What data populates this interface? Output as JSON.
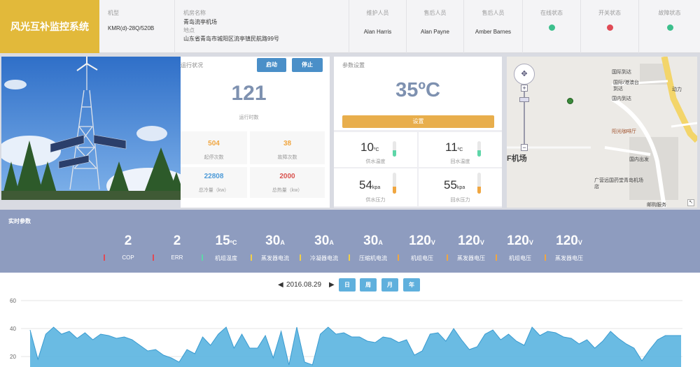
{
  "brand": "风光互补监控系统",
  "header": {
    "model_label": "机型",
    "model_value": "KMR(d)-28Q/520B",
    "room_label": "机房名称",
    "room_value": "青岛流亭机场",
    "addr_label": "地点",
    "addr_value": "山东省青岛市城阳区流亭镇民航路99号",
    "staff": [
      {
        "label": "维护人员",
        "name": "Alan Harris"
      },
      {
        "label": "售后人员",
        "name": "Alan Payne"
      },
      {
        "label": "售后人员",
        "name": "Amber Barnes"
      }
    ],
    "status": [
      {
        "label": "在线状态",
        "color": "#3cbf8c"
      },
      {
        "label": "开关状态",
        "color": "#e04a55"
      },
      {
        "label": "故障状态",
        "color": "#3cbf8c"
      }
    ]
  },
  "run": {
    "title": "运行状况",
    "start_label": "启动",
    "stop_label": "停止",
    "hours": "121",
    "hours_label": "运行时数",
    "starts_value": "504",
    "starts_label": "起停次数",
    "faults_value": "38",
    "faults_label": "故障次数",
    "cool_value": "22808",
    "cool_label": "总冷量（kw）",
    "heat_value": "2000",
    "heat_label": "总热量（kw）",
    "colors": {
      "orange": "#f0a640",
      "blue": "#4d9bd8",
      "red": "#d9534f"
    }
  },
  "params": {
    "title": "参数设置",
    "setpoint": "35ºC",
    "set_label": "设置",
    "supply_temp": "10",
    "supply_temp_unit": "ºC",
    "supply_temp_label": "供水温度",
    "return_temp": "11",
    "return_temp_unit": "ºC",
    "return_temp_label": "回水温度",
    "supply_press": "54",
    "supply_press_unit": "kpa",
    "supply_press_label": "供水压力",
    "return_press": "55",
    "return_press_unit": "kpa",
    "return_press_label": "回水压力"
  },
  "map": {
    "labels": [
      "国际到达",
      "国际/港澳台到达",
      "动力",
      "国内到达",
      "阳光咖啡厅",
      "国内出发",
      "F机场",
      "广营远国药堂青岛机场店",
      "邮购服务"
    ]
  },
  "realtime": {
    "title": "实时参数",
    "items": [
      {
        "value": "2",
        "unit": "",
        "label": "COP",
        "color": "#e04a55"
      },
      {
        "value": "2",
        "unit": "",
        "label": "ERR",
        "color": "#e04a55"
      },
      {
        "value": "15",
        "unit": "ºC",
        "label": "机组温度",
        "color": "#5ed6a8"
      },
      {
        "value": "30",
        "unit": "A",
        "label": "蒸发器电流",
        "color": "#f2d048"
      },
      {
        "value": "30",
        "unit": "A",
        "label": "冷凝器电流",
        "color": "#f2d048"
      },
      {
        "value": "30",
        "unit": "A",
        "label": "压缩机电流",
        "color": "#f2d048"
      },
      {
        "value": "120",
        "unit": "V",
        "label": "机组电压",
        "color": "#f0a640"
      },
      {
        "value": "120",
        "unit": "V",
        "label": "蒸发器电压",
        "color": "#f0a640"
      },
      {
        "value": "120",
        "unit": "V",
        "label": "机组电压",
        "color": "#f0a640"
      },
      {
        "value": "120",
        "unit": "V",
        "label": "蒸发器电压",
        "color": "#f0a640"
      }
    ]
  },
  "chart_toolbar": {
    "prev_icon": "◀",
    "next_icon": "▶",
    "date": "2016.08.29",
    "day": "日",
    "week": "周",
    "month": "月",
    "year": "年"
  },
  "chart_data": {
    "type": "area",
    "yticks": [
      "60",
      "40",
      "20"
    ],
    "ylim": [
      0,
      62
    ],
    "color": "#5ab4e0",
    "values": [
      39,
      18,
      36,
      41,
      36,
      38,
      33,
      37,
      32,
      36,
      35,
      33,
      34,
      32,
      28,
      24,
      25,
      21,
      19,
      16,
      25,
      22,
      34,
      28,
      36,
      41,
      26,
      36,
      26,
      26,
      35,
      19,
      38,
      14,
      41,
      16,
      14,
      36,
      41,
      36,
      37,
      34,
      34,
      31,
      30,
      34,
      33,
      30,
      32,
      21,
      24,
      36,
      37,
      31,
      40,
      32,
      25,
      27,
      36,
      39,
      32,
      36,
      31,
      28,
      41,
      35,
      38,
      37,
      34,
      33,
      29,
      32,
      26,
      31,
      38,
      33,
      29,
      26,
      17,
      25,
      32,
      35,
      35,
      35
    ]
  }
}
